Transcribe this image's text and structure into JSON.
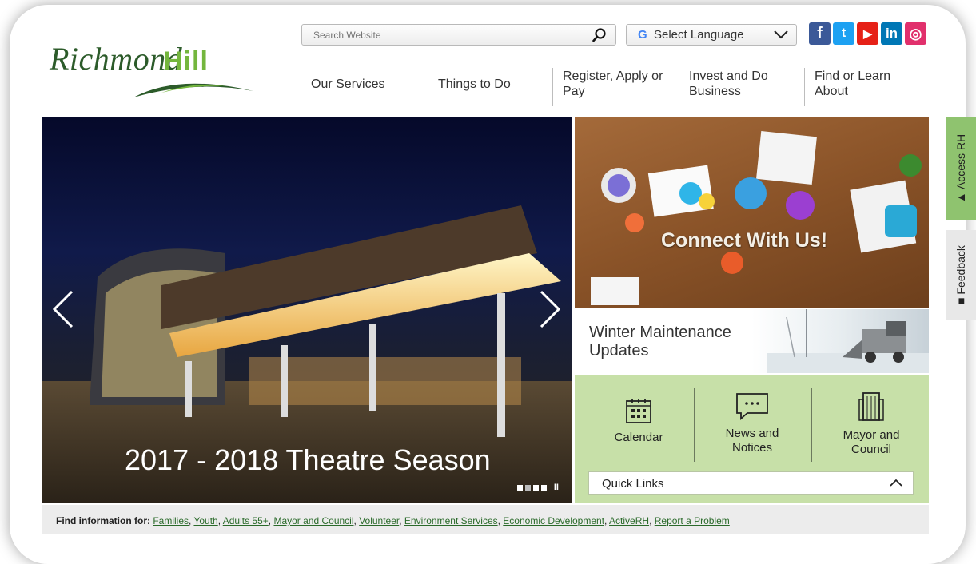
{
  "header": {
    "logo": {
      "script_text": "Richmond",
      "hill_text": "Hill"
    },
    "search": {
      "placeholder": "Search Website",
      "icon": "search-icon"
    },
    "language": {
      "g_glyph": "G",
      "label": "Select Language",
      "icon": "chevron-down-icon"
    },
    "social": [
      {
        "label": "f",
        "icon": "facebook-icon",
        "color": "#3b5998"
      },
      {
        "label": "t",
        "icon": "twitter-icon",
        "color": "#1da1f2"
      },
      {
        "label": "▶",
        "icon": "youtube-icon",
        "color": "#e62117"
      },
      {
        "label": "in",
        "icon": "linkedin-icon",
        "color": "#0077b5"
      },
      {
        "label": "◎",
        "icon": "instagram-icon",
        "color": "#e1306c"
      }
    ]
  },
  "nav": {
    "items": [
      {
        "label": "Our Services"
      },
      {
        "label": "Things to Do"
      },
      {
        "label": "Register, Apply or Pay"
      },
      {
        "label": "Invest and Do Business"
      },
      {
        "label": "Find or Learn About"
      }
    ]
  },
  "hero": {
    "caption": "2017 - 2018 Theatre Season",
    "prev_icon": "chevron-left-icon",
    "next_icon": "chevron-right-icon",
    "slides_total": 4,
    "slide_active": 1,
    "pause_label": "II"
  },
  "promo": {
    "connect": {
      "label": "Connect With Us!"
    },
    "winter": {
      "label": "Winter Maintenance Updates"
    }
  },
  "quick_tiles": [
    {
      "label": "Calendar",
      "icon": "calendar-icon"
    },
    {
      "label": "News and Notices",
      "icon": "chat-bubble-icon"
    },
    {
      "label": "Mayor and Council",
      "icon": "building-icon"
    }
  ],
  "quick_links": {
    "label": "Quick Links",
    "icon": "chevron-up-icon"
  },
  "side_tabs": [
    {
      "label": "Access RH",
      "icon": "user-icon"
    },
    {
      "label": "Feedback",
      "icon": "comment-icon"
    }
  ],
  "find_info": {
    "prefix": "Find information for:",
    "links": [
      "Families",
      "Youth",
      "Adults 55+",
      "Mayor and Council",
      "Volunteer",
      "Environment Services",
      "Economic Development",
      "ActiveRH",
      "Report a Problem"
    ]
  },
  "colors": {
    "green_panel": "#c7e0a8",
    "side_tab": "#8fc36f",
    "logo_dark": "#2c5b2a",
    "logo_light": "#74b63d"
  }
}
